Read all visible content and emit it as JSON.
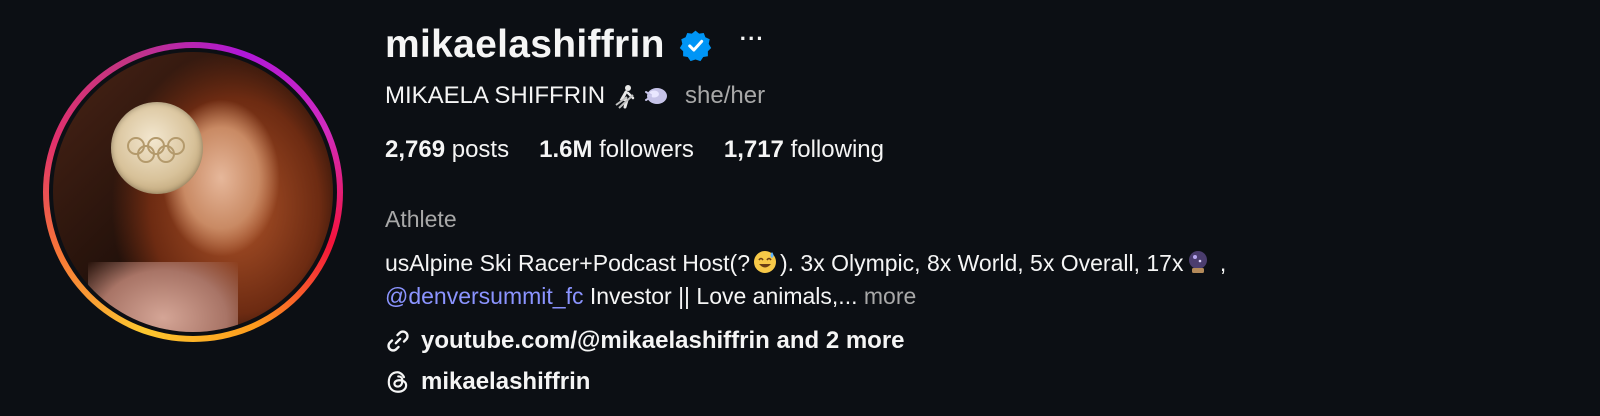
{
  "profile": {
    "username": "mikaelashiffrin",
    "more_label": "···",
    "full_name": "MIKAELA SHIFFRIN",
    "pronouns": "she/her",
    "stats": {
      "posts_count": "2,769",
      "posts_label": "posts",
      "followers_count": "1.6M",
      "followers_label": "followers",
      "following_count": "1,717",
      "following_label": "following"
    },
    "category": "Athlete",
    "bio": {
      "line1_a": "usAlpine Ski Racer+Podcast Host(?",
      "line1_b": "). 3x Olympic, 8x World, 5x Overall, 17x",
      "line1_c": " ,",
      "mention": "@denversummit_fc",
      "line2": " Investor || Love animals,...",
      "more": "more"
    },
    "link_text": "youtube.com/@mikaelashiffrin and 2 more",
    "threads_handle": "mikaelashiffrin"
  },
  "colors": {
    "background": "#0c0f14",
    "verified": "#0095f6",
    "mention": "#8b94ff",
    "secondary_text": "#a8a8a8"
  },
  "icons": [
    "verified-badge-icon",
    "more-options-icon",
    "skier-emoji-icon",
    "snowflake-emoji-icon",
    "sweat-smile-emoji-icon",
    "crystal-globe-emoji-icon",
    "link-icon",
    "threads-icon"
  ]
}
